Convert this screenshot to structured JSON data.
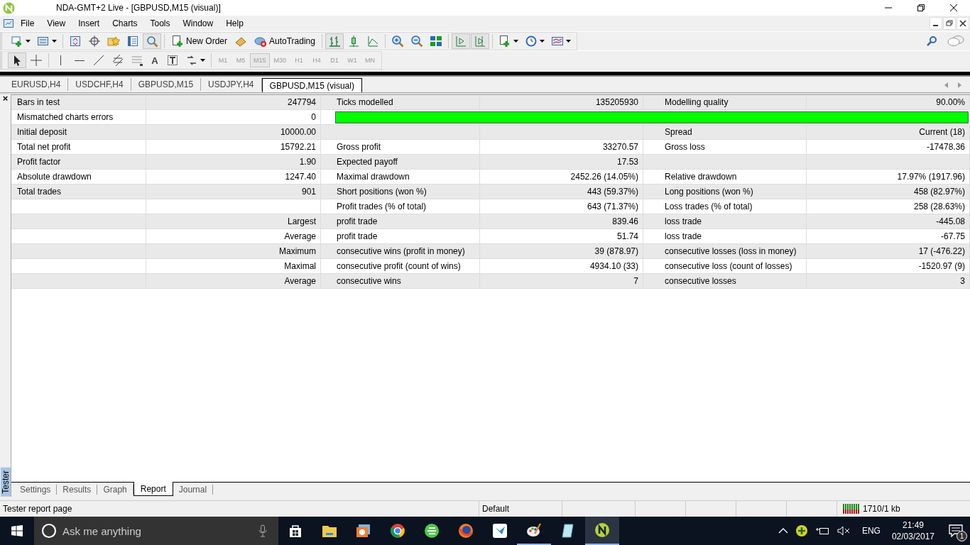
{
  "window": {
    "title": "NDA-GMT+2 Live - [GBPUSD,M15 (visual)]"
  },
  "menu": [
    "File",
    "View",
    "Insert",
    "Charts",
    "Tools",
    "Window",
    "Help"
  ],
  "toolbar": {
    "new_order": "New Order",
    "autotrading": "AutoTrading"
  },
  "drawing_tools": {
    "text_tool": "A"
  },
  "timeframes": [
    {
      "label": "M1",
      "selected": false
    },
    {
      "label": "M5",
      "selected": false
    },
    {
      "label": "M15",
      "selected": true
    },
    {
      "label": "M30",
      "selected": false
    },
    {
      "label": "H1",
      "selected": false
    },
    {
      "label": "H4",
      "selected": false
    },
    {
      "label": "D1",
      "selected": false
    },
    {
      "label": "W1",
      "selected": false
    },
    {
      "label": "MN",
      "selected": false
    }
  ],
  "chart_tabs": [
    {
      "label": "EURUSD,H4",
      "selected": false
    },
    {
      "label": "USDCHF,H4",
      "selected": false
    },
    {
      "label": "GBPUSD,M15",
      "selected": false
    },
    {
      "label": "USDJPY,H4",
      "selected": false
    },
    {
      "label": "GBPUSD,M15 (visual)",
      "selected": true
    }
  ],
  "report": {
    "rows": [
      {
        "kind": "text",
        "label": "Bars in test",
        "value": "247794",
        "label_2": "Ticks modelled",
        "value_2": "135205930",
        "label_3": "Modelling quality",
        "value_3": "90.00%"
      },
      {
        "kind": "progress",
        "label": "Mismatched charts errors",
        "value": "0",
        "level": 1
      },
      {
        "kind": "text",
        "label": "Initial deposit",
        "value": "10000.00",
        "label_3": "Spread",
        "value_3": "Current (18)"
      },
      {
        "kind": "text",
        "label": "Total net profit",
        "value": "15792.21",
        "label_2": "Gross profit",
        "value_2": "33270.57",
        "label_3": "Gross loss",
        "value_3": "-17478.36"
      },
      {
        "kind": "text",
        "label": "Profit factor",
        "value": "1.90",
        "label_2": "Expected payoff",
        "value_2": "17.53"
      },
      {
        "kind": "text",
        "label": "Absolute drawdown",
        "value": "1247.40",
        "label_2": "Maximal drawdown",
        "value_2": "2452.26 (14.05%)",
        "label_3": "Relative drawdown",
        "value_3": "17.97% (1917.96)"
      },
      {
        "kind": "text",
        "label": "Total trades",
        "value": "901",
        "label_2": "Short positions (won %)",
        "value_2": "443 (59.37%)",
        "label_3": "Long positions (won %)",
        "value_3": "458 (82.97%)"
      },
      {
        "kind": "text",
        "label_2": "Profit trades (% of total)",
        "value_2": "643 (71.37%)",
        "label_3": "Loss trades (% of total)",
        "value_3": "258 (28.63%)"
      },
      {
        "kind": "text",
        "value": "Largest",
        "label_2": "profit trade",
        "value_2": "839.46",
        "label_3": "loss trade",
        "value_3": "-445.08"
      },
      {
        "kind": "text",
        "value": "Average",
        "label_2": "profit trade",
        "value_2": "51.74",
        "label_3": "loss trade",
        "value_3": "-67.75"
      },
      {
        "kind": "text",
        "value": "Maximum",
        "label_2": "consecutive wins (profit in money)",
        "value_2": "39 (878.97)",
        "label_3": "consecutive losses (loss in money)",
        "value_3": "17 (-476.22)"
      },
      {
        "kind": "text",
        "value": "Maximal",
        "label_2": "consecutive profit (count of wins)",
        "value_2": "4934.10 (33)",
        "label_3": "consecutive loss (count of losses)",
        "value_3": "-1520.97 (9)"
      },
      {
        "kind": "text",
        "value": "Average",
        "label_2": "consecutive wins",
        "value_2": "7",
        "label_3": "consecutive losses",
        "value_3": "3"
      }
    ]
  },
  "panel": {
    "title": "Tester",
    "close": "×"
  },
  "tester_tabs": [
    {
      "label": "Settings",
      "selected": false
    },
    {
      "label": "Results",
      "selected": false
    },
    {
      "label": "Graph",
      "selected": false
    },
    {
      "label": "Report",
      "selected": true
    },
    {
      "label": "Journal",
      "selected": false
    }
  ],
  "status_bar": {
    "message": "Tester report page",
    "profile": "Default",
    "traffic": "1710/1 kb"
  },
  "taskbar": {
    "search_placeholder": "Ask me anything",
    "language": "ENG",
    "time": "21:49",
    "date": "02/03/2017",
    "notifications": "1"
  }
}
